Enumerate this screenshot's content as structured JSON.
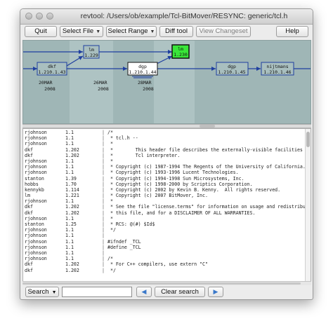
{
  "window": {
    "title": "revtool: /Users/ob/example/Tcl-BitMover/RESYNC: generic/tcl.h"
  },
  "toolbar": {
    "quit": "Quit",
    "select_file": "Select File",
    "select_range": "Select Range",
    "diff_tool": "Diff tool",
    "view_changeset": "View Changeset",
    "help": "Help"
  },
  "graph": {
    "nodes": [
      {
        "user": "dkf",
        "rev": "1.210.1.43"
      },
      {
        "user": "lm",
        "rev": "1.229"
      },
      {
        "user": "dgp",
        "rev": "1.210.1.44"
      },
      {
        "user": "lm",
        "rev": "1.230"
      },
      {
        "user": "dgp",
        "rev": "1.210.1.45"
      },
      {
        "user": "nijtmans",
        "rev": "1.210.1.46"
      }
    ],
    "dates": [
      {
        "day": "20MAR",
        "year": "2008"
      },
      {
        "day": "26MAR",
        "year": "2008"
      },
      {
        "day": "28MAR",
        "year": "2008"
      }
    ],
    "colors": {
      "background": "#9fb6b6",
      "node_selected": "#39e639",
      "edge": "#1f3f9f"
    }
  },
  "annotations": [
    {
      "user": "rjohnson",
      "rev": "1.1",
      "code": "/*"
    },
    {
      "user": "rjohnson",
      "rev": "1.1",
      "code": " * tcl.h --"
    },
    {
      "user": "rjohnson",
      "rev": "1.1",
      "code": " *"
    },
    {
      "user": "dkf",
      "rev": "1.202",
      "code": " *\tThis header file describes the externally-visible facilities of the"
    },
    {
      "user": "dkf",
      "rev": "1.202",
      "code": " *\tTcl interpreter."
    },
    {
      "user": "rjohnson",
      "rev": "1.1",
      "code": " *"
    },
    {
      "user": "rjohnson",
      "rev": "1.1",
      "code": " * Copyright (c) 1987-1994 The Regents of the University of California."
    },
    {
      "user": "rjohnson",
      "rev": "1.1",
      "code": " * Copyright (c) 1993-1996 Lucent Technologies."
    },
    {
      "user": "stanton",
      "rev": "1.39",
      "code": " * Copyright (c) 1994-1998 Sun Microsystems, Inc."
    },
    {
      "user": "hobbs",
      "rev": "1.70",
      "code": " * Copyright (c) 1998-2000 by Scriptics Corporation."
    },
    {
      "user": "kennykb",
      "rev": "1.114",
      "code": " * Copyright (c) 2002 by Kevin B. Kenny.  All rights reserved."
    },
    {
      "user": "lm",
      "rev": "1.221",
      "code": " * Copyright (c) 2007 BitMover, Inc."
    },
    {
      "user": "rjohnson",
      "rev": "1.1",
      "code": " *"
    },
    {
      "user": "dkf",
      "rev": "1.202",
      "code": " * See the file \"license.terms\" for information on usage and redistribution of"
    },
    {
      "user": "dkf",
      "rev": "1.202",
      "code": " * this file, and for a DISCLAIMER OF ALL WARRANTIES."
    },
    {
      "user": "rjohnson",
      "rev": "1.1",
      "code": " *"
    },
    {
      "user": "stanton",
      "rev": "1.25",
      "code": " * RCS: @(#) $Id$"
    },
    {
      "user": "rjohnson",
      "rev": "1.1",
      "code": " */"
    },
    {
      "user": "rjohnson",
      "rev": "1.1",
      "code": ""
    },
    {
      "user": "rjohnson",
      "rev": "1.1",
      "code": "#ifndef _TCL"
    },
    {
      "user": "rjohnson",
      "rev": "1.1",
      "code": "#define _TCL"
    },
    {
      "user": "rjohnson",
      "rev": "1.1",
      "code": ""
    },
    {
      "user": "rjohnson",
      "rev": "1.1",
      "code": "/*"
    },
    {
      "user": "dkf",
      "rev": "1.202",
      "code": " * For C++ compilers, use extern \"C\""
    },
    {
      "user": "dkf",
      "rev": "1.202",
      "code": " */"
    }
  ],
  "searchbar": {
    "search_label": "Search",
    "search_value": "",
    "prev_icon": "left-arrow-icon",
    "next_icon": "right-arrow-icon",
    "clear_label": "Clear search"
  }
}
